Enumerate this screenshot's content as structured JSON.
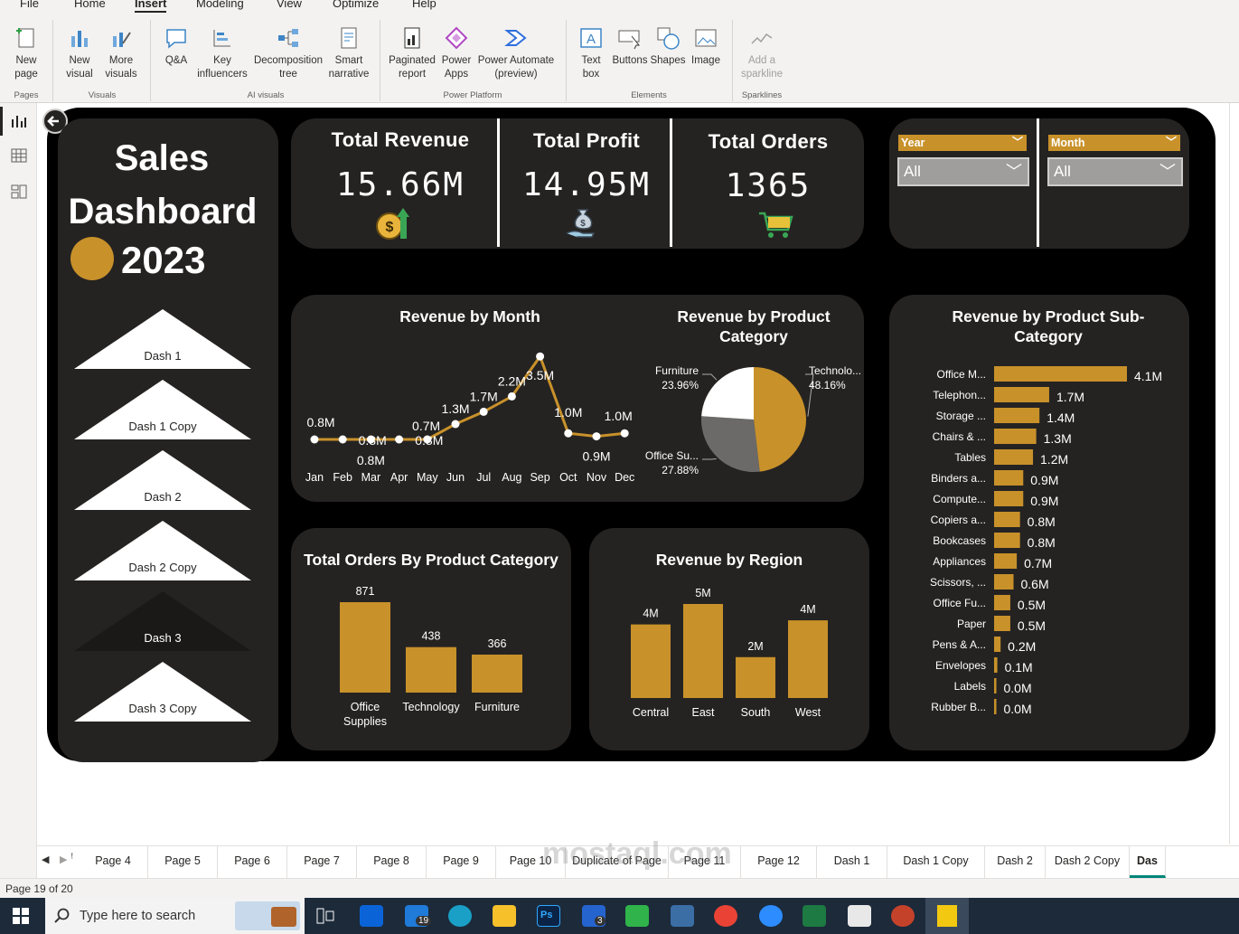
{
  "menu": {
    "items": [
      "File",
      "Home",
      "Insert",
      "Modeling",
      "View",
      "Optimize",
      "Help"
    ],
    "active": "Insert"
  },
  "ribbon": {
    "new_page": "New\npage",
    "new_visual": "New\nvisual",
    "more_visuals": "More\nvisuals",
    "qa": "Q&A",
    "key_influencers": "Key\ninfluencers",
    "decomposition_tree": "Decomposition\ntree",
    "smart_narrative": "Smart\nnarrative",
    "paginated_report": "Paginated\nreport",
    "power_apps": "Power\nApps",
    "power_automate": "Power Automate\n(preview)",
    "text_box": "Text\nbox",
    "buttons": "Buttons",
    "shapes": "Shapes",
    "image": "Image",
    "add_sparkline": "Add a\nsparkline",
    "groups": {
      "pages": "Pages",
      "visuals": "Visuals",
      "ai_visuals": "AI visuals",
      "power_platform": "Power Platform",
      "elements": "Elements",
      "sparklines": "Sparklines"
    }
  },
  "dashboard": {
    "title_line1": "Sales",
    "title_line2": "Dashboard",
    "year": "2023",
    "nav": [
      "Dash 1",
      "Dash 1 Copy",
      "Dash 2",
      "Dash 2 Copy",
      "Dash 3",
      "Dash 3 Copy"
    ],
    "active_nav": "Dash 3",
    "kpis": [
      {
        "label": "Total Revenue",
        "value": "15.66M",
        "icon": "money-growth-icon"
      },
      {
        "label": "Total Profit",
        "value": "14.95M",
        "icon": "money-bag-hand-icon"
      },
      {
        "label": "Total Orders",
        "value": "1365",
        "icon": "shopping-cart-icon"
      }
    ],
    "slicers": [
      {
        "label": "Year",
        "value": "All"
      },
      {
        "label": "Month",
        "value": "All"
      }
    ],
    "accent_color": "#c8912a"
  },
  "chart_data": [
    {
      "type": "line",
      "title": "Revenue by Month",
      "categories": [
        "Jan",
        "Feb",
        "Mar",
        "Apr",
        "May",
        "Jun",
        "Jul",
        "Aug",
        "Sep",
        "Oct",
        "Nov",
        "Dec"
      ],
      "values": [
        0.8,
        0.8,
        0.8,
        0.8,
        0.8,
        1.3,
        1.7,
        2.2,
        3.5,
        1.0,
        0.9,
        1.0
      ],
      "labels": [
        "0.8M",
        "0.8M",
        "0.8M",
        "0.7M",
        "0.8M",
        "1.3M",
        "1.7M",
        "2.2M",
        "3.5M",
        "1.0M",
        "0.9M",
        "1.0M"
      ],
      "color": "#c8912a"
    },
    {
      "type": "pie",
      "title": "Revenue by Product Category",
      "slices": [
        {
          "name": "Technolo...",
          "value": 48.16,
          "label": "48.16%",
          "color": "#c8912a"
        },
        {
          "name": "Office Su...",
          "value": 27.88,
          "label": "27.88%",
          "color": "#6b6a69"
        },
        {
          "name": "Furniture",
          "value": 23.96,
          "label": "23.96%",
          "color": "#ffffff"
        }
      ]
    },
    {
      "type": "bar",
      "title": "Total Orders By Product Category",
      "categories": [
        "Office Supplies",
        "Technology",
        "Furniture"
      ],
      "values": [
        871,
        438,
        366
      ],
      "labels": [
        "871",
        "438",
        "366"
      ]
    },
    {
      "type": "bar",
      "title": "Revenue by Region",
      "categories": [
        "Central",
        "East",
        "South",
        "West"
      ],
      "values": [
        4,
        5,
        2,
        4
      ],
      "display_values": [
        3.6,
        4.6,
        2.0,
        3.8
      ],
      "labels": [
        "4M",
        "5M",
        "2M",
        "4M"
      ]
    },
    {
      "type": "bar",
      "orientation": "horizontal",
      "title": "Revenue by Product Sub-Category",
      "categories": [
        "Office M...",
        "Telephon...",
        "Storage ...",
        "Chairs & ...",
        "Tables",
        "Binders a...",
        "Compute...",
        "Copiers a...",
        "Bookcases",
        "Appliances",
        "Scissors, ...",
        "Office Fu...",
        "Paper",
        "Pens & A...",
        "Envelopes",
        "Labels",
        "Rubber B..."
      ],
      "values": [
        4.1,
        1.7,
        1.4,
        1.3,
        1.2,
        0.9,
        0.9,
        0.8,
        0.8,
        0.7,
        0.6,
        0.5,
        0.5,
        0.2,
        0.1,
        0.0,
        0.0
      ],
      "labels": [
        "4.1M",
        "1.7M",
        "1.4M",
        "1.3M",
        "1.2M",
        "0.9M",
        "0.9M",
        "0.8M",
        "0.8M",
        "0.7M",
        "0.6M",
        "0.5M",
        "0.5M",
        "0.2M",
        "0.1M",
        "0.0M",
        "0.0M"
      ]
    }
  ],
  "tabs": [
    "Page 4",
    "Page 5",
    "Page 6",
    "Page 7",
    "Page 8",
    "Page 9",
    "Page 10",
    "Duplicate of Page 10",
    "Page 11",
    "Page 12",
    "Dash 1",
    "Dash 1 Copy",
    "Dash 2",
    "Dash 2 Copy",
    "Das"
  ],
  "status": "Page 19 of 20",
  "taskbar": {
    "search_placeholder": "Type here to search",
    "mail_badge": "19",
    "todo_badge": "3"
  },
  "watermark": "مستقل mostaql.com"
}
